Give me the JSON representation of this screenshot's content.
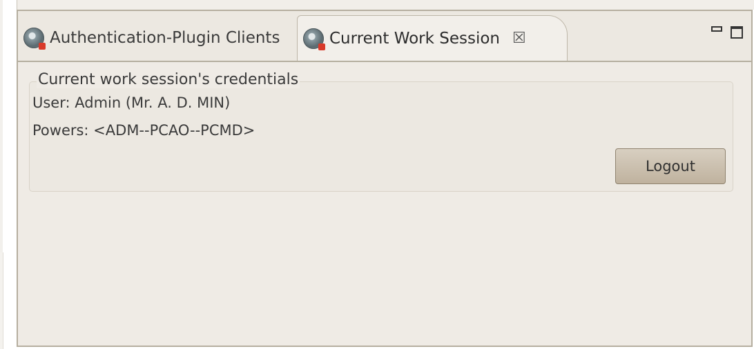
{
  "tabs": [
    {
      "label": "Authentication-Plugin Clients",
      "icon": "plugin-icon",
      "active": false
    },
    {
      "label": "Current Work Session",
      "icon": "plugin-icon",
      "active": true,
      "close_glyph": "☒"
    }
  ],
  "view_controls": {
    "minimize_icon": "minimize-icon",
    "maximize_icon": "maximize-icon"
  },
  "credentials": {
    "group_title": "Current work session's credentials",
    "user": "User: Admin (Mr. A. D. MIN)",
    "powers": "Powers: <ADM--PCAO--PCMD>",
    "logout_label": "Logout"
  }
}
